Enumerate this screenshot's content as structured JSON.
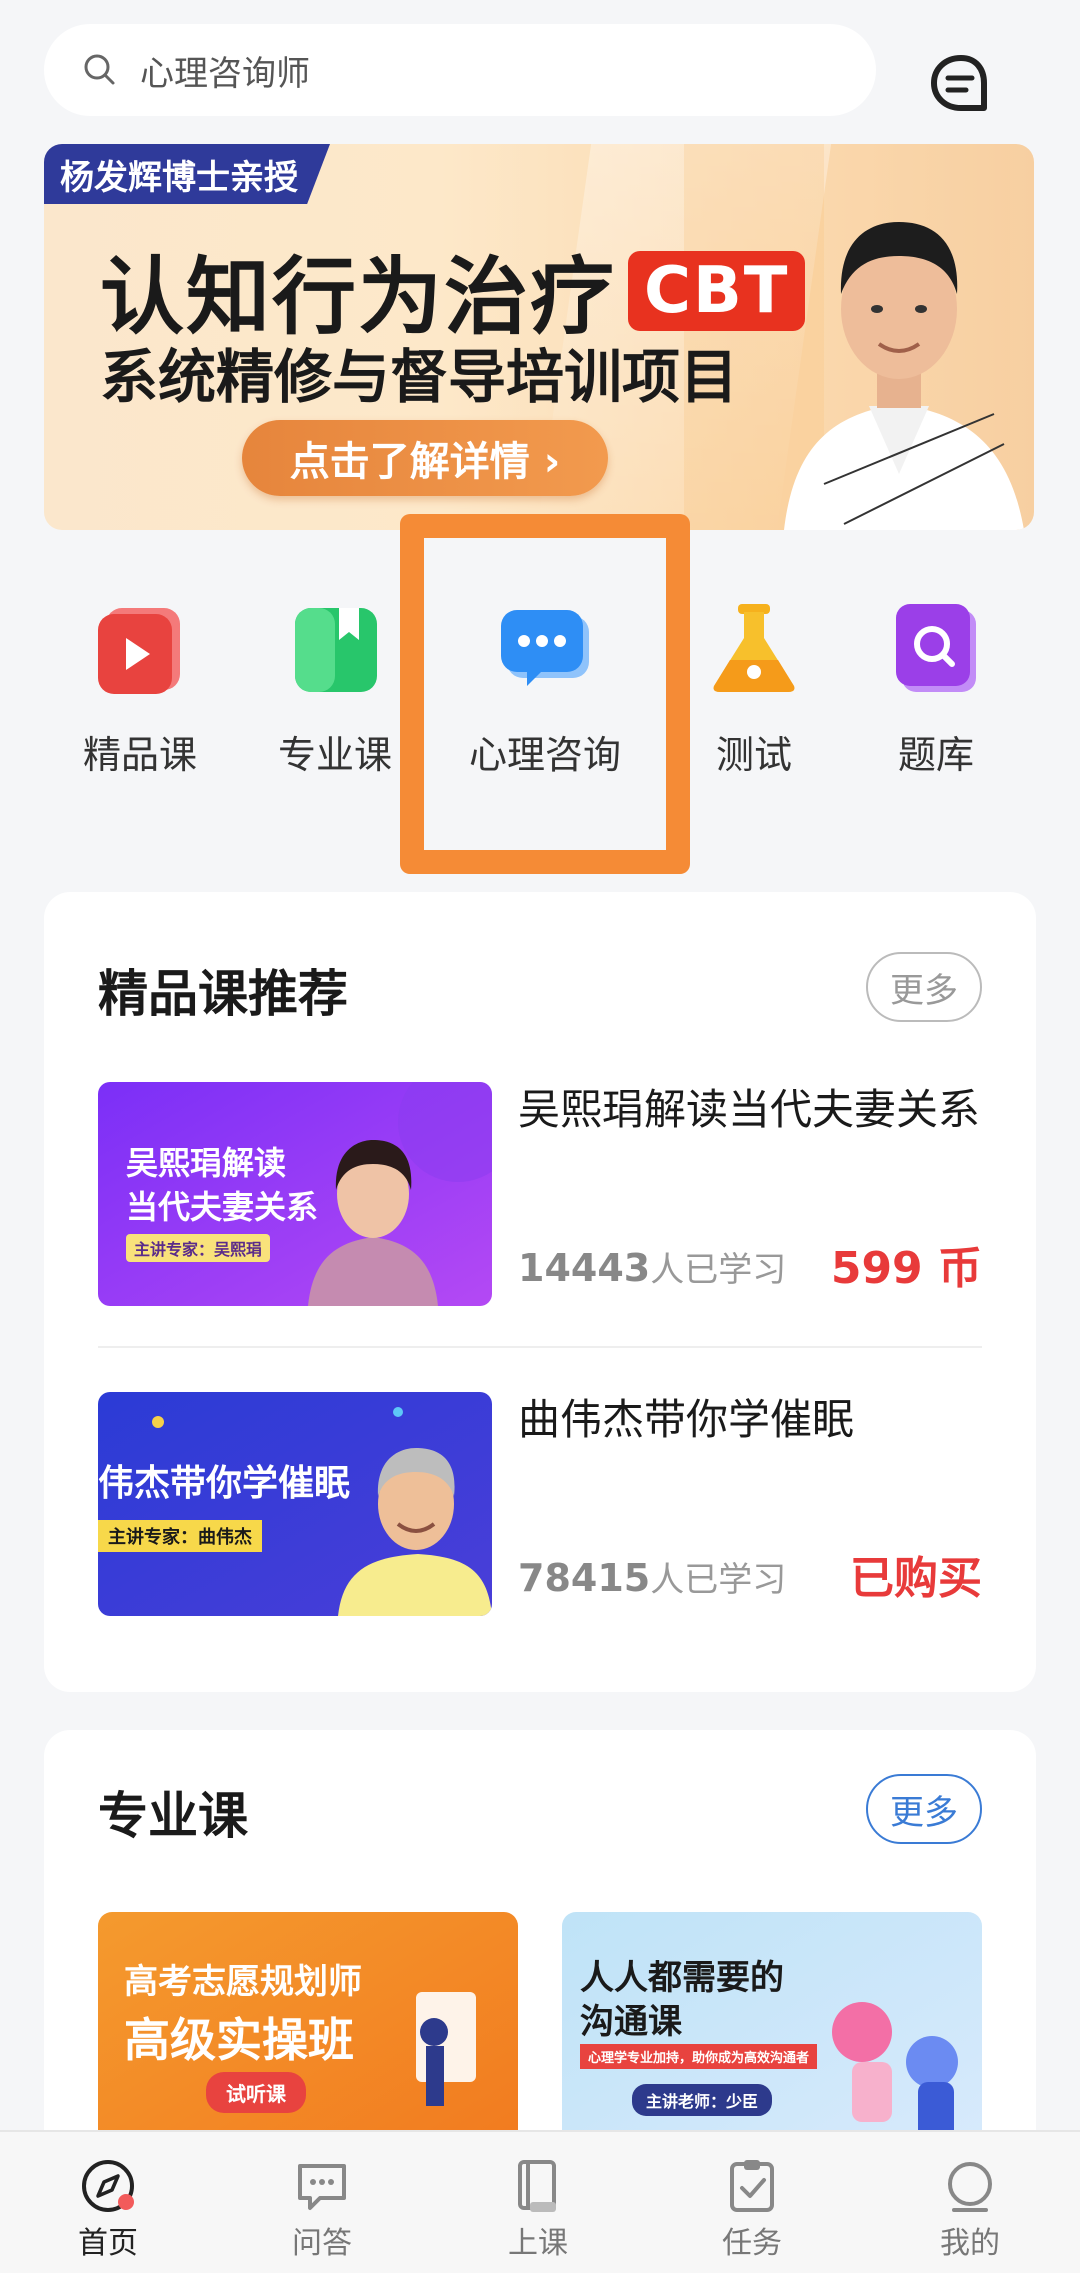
{
  "search": {
    "placeholder": "心理咨询师"
  },
  "banner": {
    "tag": "杨发辉博士亲授",
    "title": "认知行为治疗",
    "badge": "CBT",
    "subtitle": "系统精修与督导培训项目",
    "button": "点击了解详情 ›"
  },
  "quick_nav": [
    {
      "label": "精品课",
      "icon": "video-play-icon"
    },
    {
      "label": "专业课",
      "icon": "book-icon"
    },
    {
      "label": "心理咨询",
      "icon": "chat-bubble-icon"
    },
    {
      "label": "测试",
      "icon": "flask-icon"
    },
    {
      "label": "题库",
      "icon": "search-book-icon"
    }
  ],
  "premium": {
    "title": "精品课推荐",
    "more": "更多",
    "courses": [
      {
        "thumb_line1": "吴熙琄解读",
        "thumb_line2": "当代夫妻关系",
        "thumb_caption": "主讲专家：吴熙琄",
        "title": "吴熙琄解读当代夫妻关系",
        "learners": "14443",
        "learners_suffix": "人已学习",
        "price": "599 币"
      },
      {
        "thumb_line1": "伟杰带你学催眠",
        "thumb_caption": "主讲专家：曲伟杰",
        "title": "曲伟杰带你学催眠",
        "learners": "78415",
        "learners_suffix": "人已学习",
        "price": "已购买"
      }
    ]
  },
  "professional": {
    "title": "专业课",
    "more": "更多",
    "courses": [
      {
        "thumb_line1": "高考志愿规划师",
        "thumb_line2": "高级实操班",
        "thumb_tag": "试听课"
      },
      {
        "thumb_line1": "人人都需要的",
        "thumb_line2": "沟通课",
        "thumb_caption": "心理学专业加持，助你成为高效沟通者",
        "thumb_tag": "主讲老师：少臣"
      }
    ]
  },
  "bottom_nav": [
    {
      "label": "首页",
      "icon": "compass-icon",
      "active": true
    },
    {
      "label": "问答",
      "icon": "qa-icon",
      "active": false
    },
    {
      "label": "上课",
      "icon": "course-book-icon",
      "active": false
    },
    {
      "label": "任务",
      "icon": "clipboard-check-icon",
      "active": false
    },
    {
      "label": "我的",
      "icon": "profile-icon",
      "active": false
    }
  ],
  "colors": {
    "accent_orange": "#f58b36",
    "price_red": "#e83a3a",
    "link_blue": "#3a7bd5",
    "banner_tag": "#2f3a9a"
  }
}
